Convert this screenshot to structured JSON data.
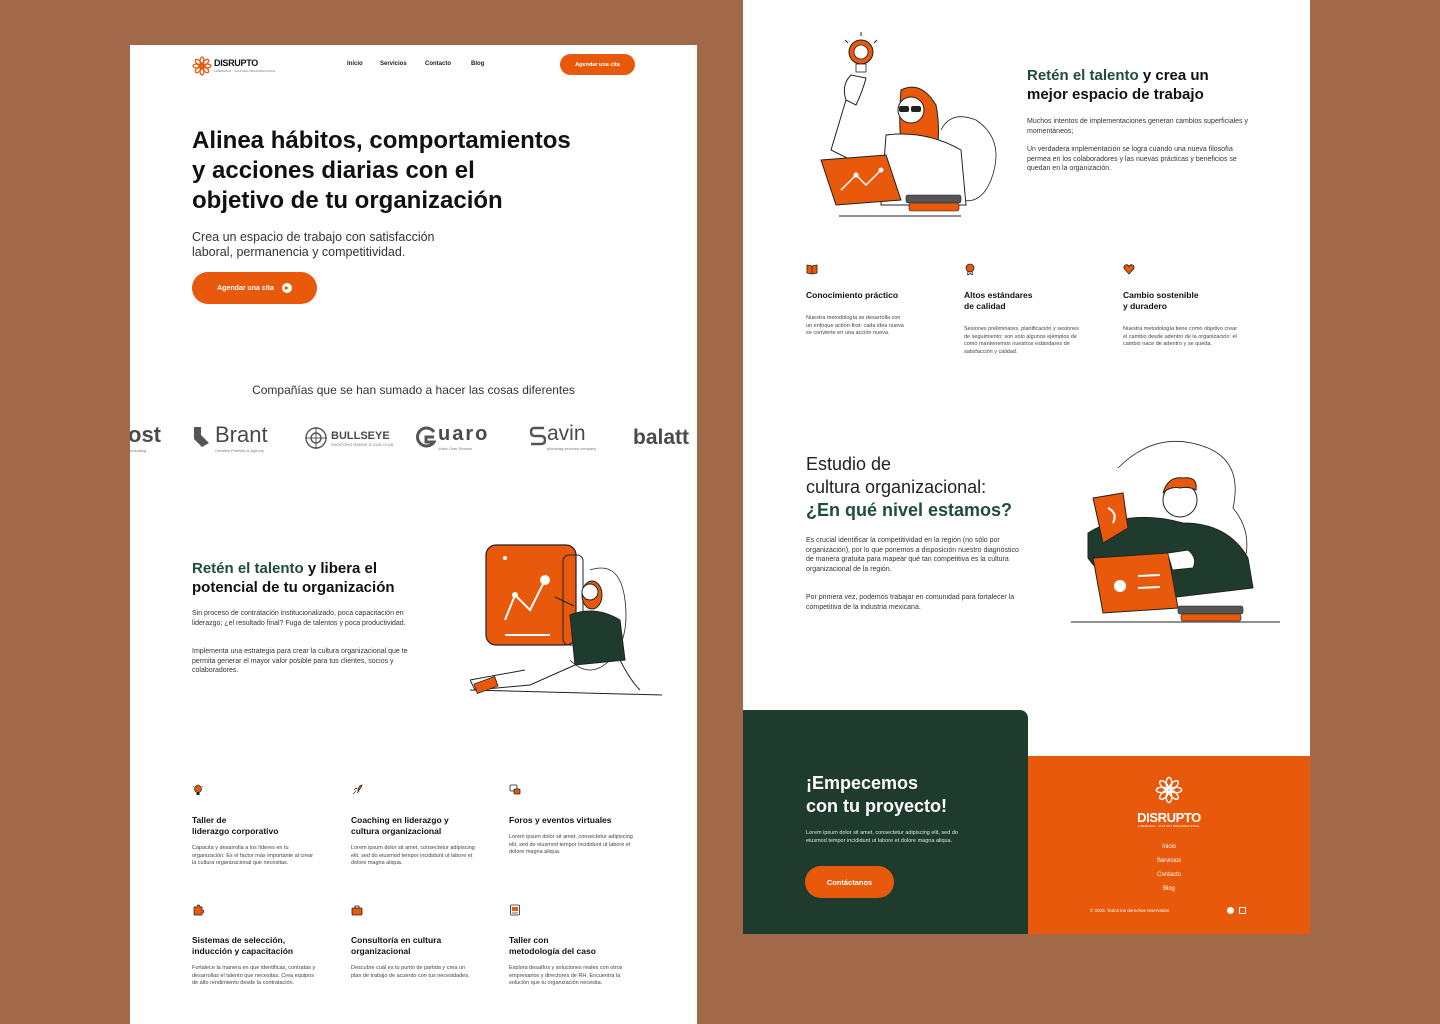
{
  "brand": {
    "name": "DISRUPTO",
    "tagline": "LIDERAZGO · CULTURA ORGANIZACIONAL"
  },
  "nav": {
    "items": [
      "Inicio",
      "Servicios",
      "Contacto",
      "Blog"
    ],
    "cta": "Agendar una cita"
  },
  "hero": {
    "title_line1": "Alinea hábitos, comportamientos",
    "title_line2": "y acciones diarias con el",
    "title_line3": "objetivo de tu organización",
    "subtitle_line1": "Crea un espacio de trabajo con satisfacción",
    "subtitle_line2": "laboral, permanencia y competitividad.",
    "button": "Agendar una cita"
  },
  "companies": {
    "heading": "Compañías que se han sumado a hacer las cosas diferentes",
    "logos": [
      {
        "name": "ost",
        "sub": "consulting"
      },
      {
        "name": "Brant",
        "sub": "Creative Portfolio & Agency"
      },
      {
        "name": "BULLSEYE",
        "sub": "SHOOTING RANGE & GUN CLUB"
      },
      {
        "name": "uaro",
        "sub": "Voice Over Service"
      },
      {
        "name": "avin",
        "sub": "plumbing services company"
      },
      {
        "name": "balatt",
        "sub": ""
      }
    ]
  },
  "retain": {
    "title_accent": "Retén el talento",
    "title_rest": " y libera el",
    "title_line2": "potencial de tu organización",
    "p1": "Sin proceso de contratación institucionalizado, poca capacitación en liderazgo; ¿el resultado final? Fuga de talentos y poca productividad.",
    "p2": "Implementa una estrategia para crear la cultura organizacional que te permita generar el mayor valor posible para tus clientes, socios y colaboradores."
  },
  "services": [
    {
      "icon": "lightbulb-icon",
      "title1": "Taller de",
      "title2": "liderazgo corporativo",
      "desc": "Capacita y desarrolla a los líderes en tu organización. Es el factor más importante al crear la cultura organizacional que necesitas."
    },
    {
      "icon": "rocket-icon",
      "title1": "Coaching en liderazgo y",
      "title2": "cultura organizacional",
      "desc": "Lorem ipsum dolor sit amet, consectetur adipiscing elit, sed do eiusmod tempor incididunt ut labore et dolore magna aliqua."
    },
    {
      "icon": "chat-icon",
      "title1": "Foros y eventos virtuales",
      "title2": "",
      "desc": "Lorem ipsum dolor sit amet, consectetur adipiscing elit, sed do eiusmod tempor incididunt ut labore et dolore magna aliqua."
    },
    {
      "icon": "puzzle-icon",
      "title1": "Sistemas de selección,",
      "title2": "inducción y capacitación",
      "desc": "Fortalece la manera en que identificas, contratas y desarrollas el talento que necesitas. Crea equipos de alto rendimiento desde la contratación."
    },
    {
      "icon": "briefcase-icon",
      "title1": "Consultoría en cultura",
      "title2": "organizacional",
      "desc": "Descubre cuál es tu punto de partida y crea un plan de trabajo de acuerdo con tus necesidades."
    },
    {
      "icon": "clipboard-icon",
      "title1": "Taller con",
      "title2": "metodología del caso",
      "desc": "Explora desafíos y soluciones reales con otros empresarios y directores de RH. Encuentra la solución que tu organización necesita."
    }
  ],
  "right_retain": {
    "title_accent": "Retén el talento",
    "title_rest": " y crea un",
    "title_line2": "mejor espacio de trabajo",
    "p1": "Muchos intentos de implementaciones generan cambios superficiales y momentáneos;",
    "p2": "Un verdadera implementación se logra cuando una nueva filosofía permea en los colaboradores y las nuevas prácticas y beneficios se quedan en la organización."
  },
  "features": [
    {
      "icon": "book-icon",
      "title1": "Conocimiento práctico",
      "title2": "",
      "desc": "Nuestra metodología se desarrolla con un enfoque action-first: cada idea nueva se convierte en una acción nueva."
    },
    {
      "icon": "award-icon",
      "title1": "Altos estándares",
      "title2": "de calidad",
      "desc": "Sesiones preliminares, planificación y sesiones de seguimiento; son solo algunos ejemplos de como mantenemos nuestros estándares de satisfacción y calidad."
    },
    {
      "icon": "heart-icon",
      "title1": "Cambio sostenible",
      "title2": "y duradero",
      "desc": "Nuestra metodología tiene como objetivo crear el cambio desde adentro de la organización: el cambio nace de adentro y se queda."
    }
  ],
  "study": {
    "line1": "Estudio de",
    "line2": "cultura organizacional:",
    "line3": "¿En qué nivel estamos?",
    "p1": "Es crucial identificar la competitividad en la región (no sólo por organización), por lo que ponemos a disposición nuestro diagnóstico de manera gratuita para mapear qué tan competitiva es la cultura organizacional de la región.",
    "p2": "Por primera vez, podemos trabajar en comunidad para fortalecer la competitiva de la industria mexicana."
  },
  "cta": {
    "title1": "¡Empecemos",
    "title2": "con tu proyecto!",
    "desc": "Lorem ipsum dolor sit amet, consectetur adipiscing elit, sed do eiusmod tempor incididunt ut labore et dolore magna aliqua.",
    "button": "Contáctanos"
  },
  "footer": {
    "links": [
      "Inicio",
      "Servicios",
      "Contacto",
      "Blog"
    ],
    "copyright": "© 2023. Todos los derechos reservados"
  },
  "colors": {
    "accent": "#e8590c",
    "dark_green": "#1f3b2e",
    "background": "#a2684a"
  }
}
